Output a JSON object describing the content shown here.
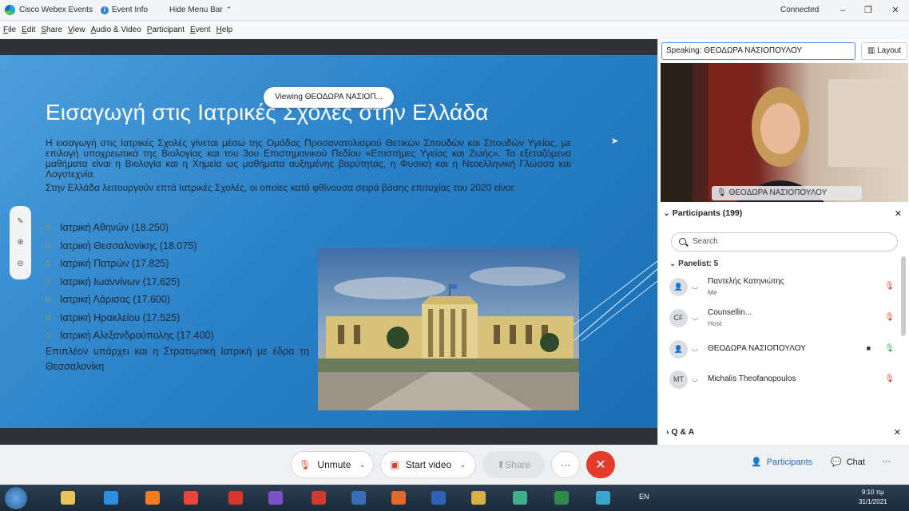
{
  "titlebar": {
    "app_name": "Cisco Webex Events",
    "event_info": "Event Info",
    "hide_menu": "Hide Menu Bar",
    "connection_status": "Connected",
    "minimize": "–",
    "maximize": "❐",
    "close": "✕"
  },
  "menu": [
    "File",
    "Edit",
    "Share",
    "View",
    "Audio & Video",
    "Participant",
    "Event",
    "Help"
  ],
  "stage": {
    "viewing_label": "Viewing ΘΕΟΔΩΡΑ ΝΑΣΙΟΠ...",
    "slide_title": "Εισαγωγή στις Ιατρικές Σχολές στην Ελλάδα",
    "paragraph_1": "Η εισαγωγή στις Ιατρικές Σχολές γίνεται μέσω της Ομάδας Προσανατολισμού Θετικών Σπουδών και Σπουδών Υγείας, με επιλογή υποχρεωτικά της Βιολογίας και του 3ου Επιστημονικού Πεδίου «Επιστήμες Υγείας και Ζωής». Τα εξεταζόμενα μαθήματα είναι η Βιολογία και η Χημεία ως μαθήματα αυξημένης βαρύτητας, η Φυσική και η Νεοελληνική Γλώσσα και Λογοτεχνία.",
    "paragraph_2": "Στην Ελλάδα λειτουργούν επτά Ιατρικές Σχολές, οι οποίες κατά φθίνουσα σειρά βάσης επιτυχίας του 2020 είναι:",
    "schools": [
      "Ιατρική Αθηνών (18.250)",
      "Ιατρική Θεσσαλονίκης (18.075)",
      "Ιατρική Πατρών (17.825)",
      "Ιατρική Ιωαννίνων (17.625)",
      "Ιατρική Λάρισας (17.600)",
      "Ιατρική Ηρακλείου (17.525)",
      "Ιατρική Αλεξανδρούπολης (17.400)"
    ],
    "note": "Επιπλέον υπάρχει και η Στρατιωτική Ιατρική με έδρα τη Θεσσαλονίκη"
  },
  "right_panel": {
    "speaking": "Speaking: ΘΕΟΔΩΡΑ ΝΑΣΙΟΠΟΥΛΟΥ",
    "layout_button": "Layout",
    "video_name": "ΘΕΟΔΩΡΑ ΝΑΣΙΟΠΟΥΛΟΥ",
    "participants_title": "Participants (199)",
    "search_placeholder": "Search",
    "panelist_header": "Panelist: 5",
    "panelists": [
      {
        "initials": "",
        "name": "Παντελής Κατηνιώτης",
        "role": "Me"
      },
      {
        "initials": "CF",
        "name": "Counsellin...",
        "role": "Host"
      },
      {
        "initials": "",
        "name": "ΘΕΟΔΩΡΑ ΝΑΣΙΟΠΟΥΛΟΥ",
        "role": ""
      },
      {
        "initials": "MT",
        "name": "Michalis Theofanopoulos",
        "role": ""
      }
    ],
    "qa_label": "Q & A"
  },
  "controls": {
    "unmute": "Unmute",
    "start_video": "Start video",
    "share": "Share",
    "more": "···",
    "leave": "✕",
    "participants": "Participants",
    "chat": "Chat",
    "overflow": "···"
  },
  "taskbar": {
    "language": "EN",
    "time": "9:10 πμ",
    "date": "31/1/2021"
  },
  "colors": {
    "accent": "#2b82c8",
    "leave_red": "#e23d2b",
    "muted_red": "#e23d2b"
  }
}
